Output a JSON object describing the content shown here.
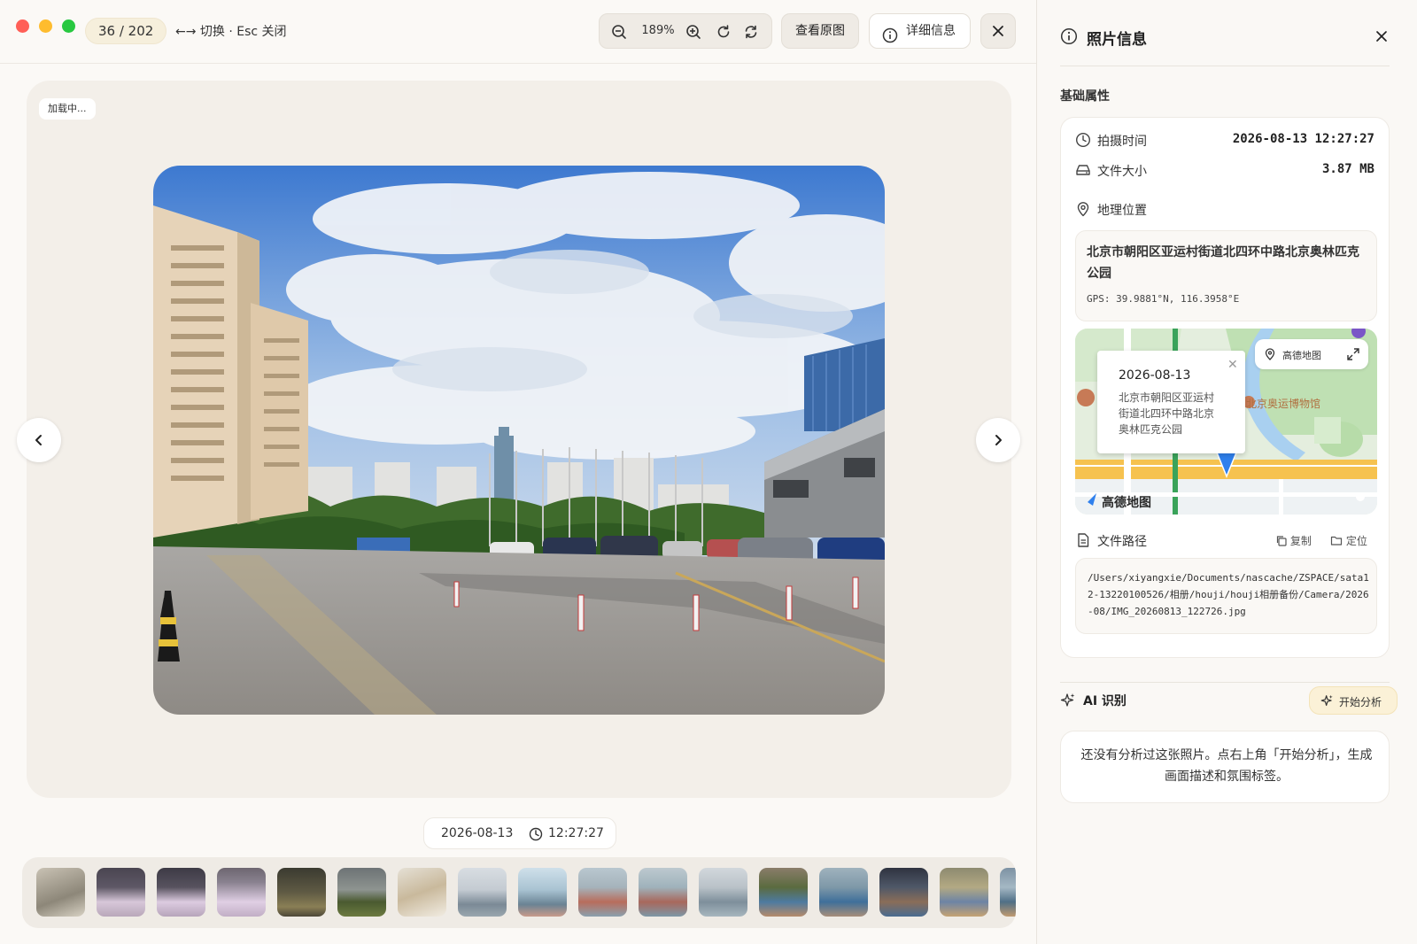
{
  "window": {
    "counter": "36 / 202",
    "hint": "←→ 切换 · Esc 关闭"
  },
  "toolbar": {
    "zoom_level": "189%",
    "view_original_label": "查看原图",
    "details_label": "详细信息"
  },
  "viewer": {
    "loading_text": "加载中...",
    "date": "2026-08-13",
    "time": "12:27:27"
  },
  "panel": {
    "title": "照片信息",
    "basic_section_title": "基础属性",
    "capture_time_label": "拍摄时间",
    "capture_time_value": "2026-08-13 12:27:27",
    "file_size_label": "文件大小",
    "file_size_value": "3.87 MB",
    "location_label": "地理位置",
    "location_address": "北京市朝阳区亚运村街道北四环中路北京奥林匹克公园",
    "location_gps": "GPS: 39.9881°N, 116.3958°E",
    "map": {
      "popup_date": "2026-08-13",
      "popup_address": "北京市朝阳区亚运村街道北四环中路北京奥林匹克公园",
      "badge_label": "高德地图",
      "logo_text": "高德地图",
      "poi_label": "北京奥运博物馆"
    },
    "file_path_label": "文件路径",
    "copy_label": "复制",
    "locate_label": "定位",
    "file_path_value": "/Users/xiyangxie/Documents/nascache/ZSPACE/sata12-13220100526/相册/houji/houji相册备份/Camera/2026-08/IMG_20260813_122726.jpg",
    "ai_title": "AI 识别",
    "ai_button_label": "开始分析",
    "ai_placeholder": "还没有分析过这张照片。点右上角「开始分析」，生成画面描述和氛围标签。"
  },
  "colors": {
    "accent_yellow": "#fbf1d7",
    "traffic_red": "#ff5f57",
    "traffic_yellow": "#febc2e",
    "traffic_green": "#28c840",
    "map_pin": "#2f80ed"
  }
}
